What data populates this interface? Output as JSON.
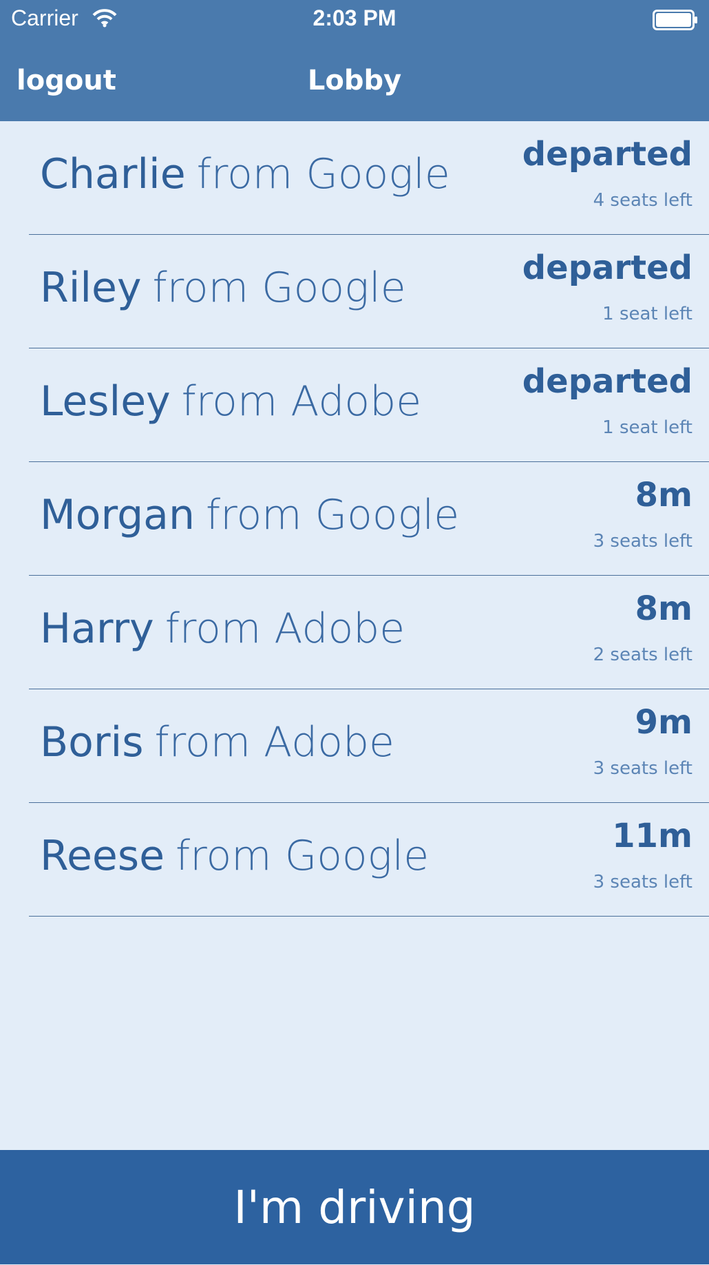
{
  "status_bar": {
    "carrier": "Carrier",
    "time": "2:03 PM",
    "icons": [
      "wifi-icon",
      "battery-icon"
    ]
  },
  "nav": {
    "left_label": "logout",
    "title": "Lobby"
  },
  "rides": [
    {
      "name": "Charlie",
      "company": "from Google",
      "status": "departed",
      "seats": "4 seats left"
    },
    {
      "name": "Riley",
      "company": "from Google",
      "status": "departed",
      "seats": "1 seat left"
    },
    {
      "name": "Lesley",
      "company": "from Adobe",
      "status": "departed",
      "seats": "1 seat left"
    },
    {
      "name": "Morgan",
      "company": "from Google",
      "status": "8m",
      "seats": "3 seats left"
    },
    {
      "name": "Harry",
      "company": "from Adobe",
      "status": "8m",
      "seats": "2 seats left"
    },
    {
      "name": "Boris",
      "company": "from Adobe",
      "status": "9m",
      "seats": "3 seats left"
    },
    {
      "name": "Reese",
      "company": "from Google",
      "status": "11m",
      "seats": "3 seats left"
    }
  ],
  "footer": {
    "drive_label": "I'm driving"
  },
  "colors": {
    "header_bg": "#4a7aad",
    "list_bg": "#e3edf8",
    "text_primary": "#2f5f98",
    "footer_bg": "#2d62a0"
  }
}
